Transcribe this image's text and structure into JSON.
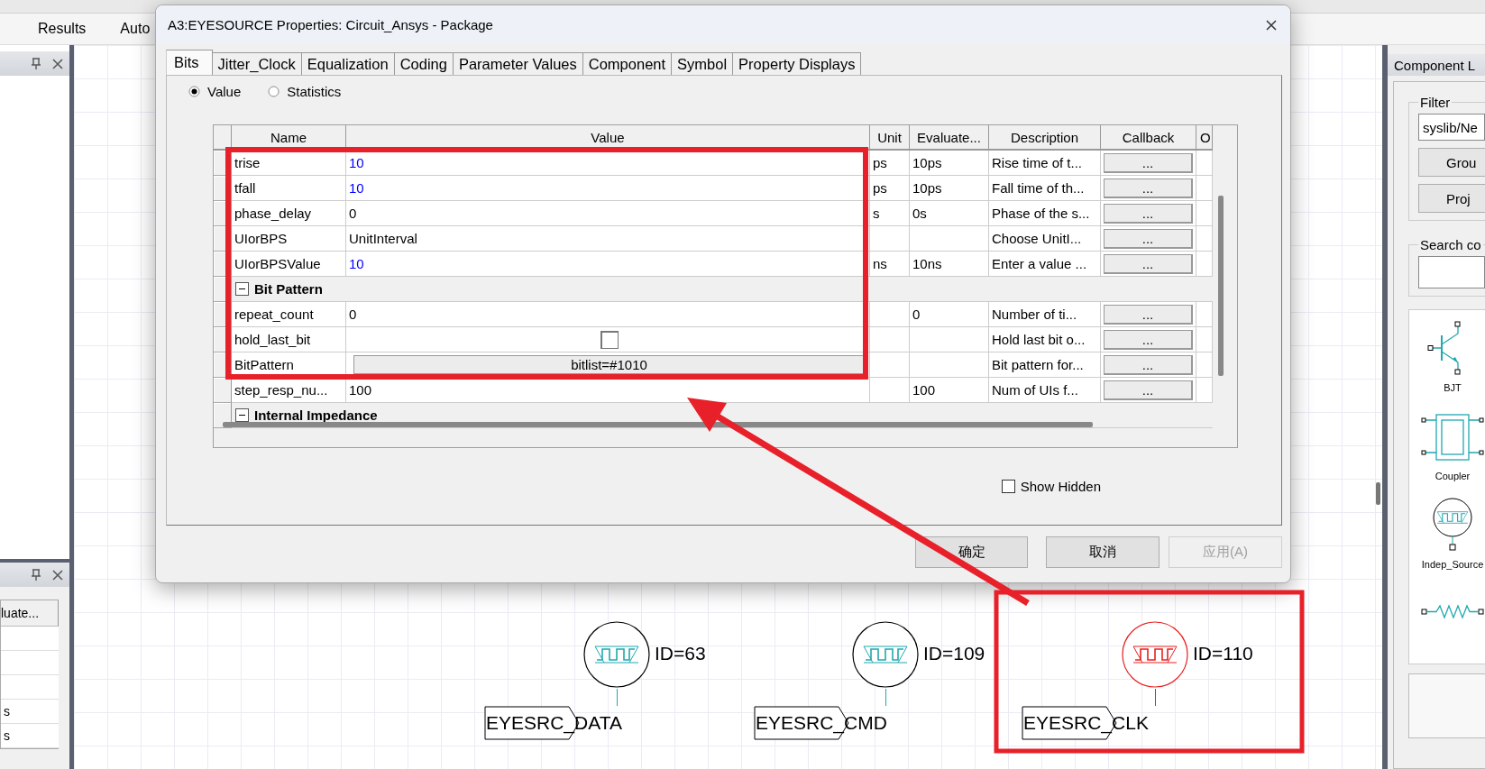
{
  "menu": [
    {
      "label": "Results"
    },
    {
      "label": "Auto"
    }
  ],
  "left_panel": {
    "table": {
      "columns": [
        "luate..."
      ],
      "cells": [
        "s",
        "s"
      ]
    }
  },
  "schematic": {
    "symbols": [
      {
        "id_label": "ID=63",
        "port": "EYESRC_DATA",
        "selected": false
      },
      {
        "id_label": "ID=109",
        "port": "EYESRC_CMD",
        "selected": false
      },
      {
        "id_label": "ID=110",
        "port": "EYESRC_CLK",
        "selected": true
      }
    ]
  },
  "library": {
    "title": "Component L",
    "filter_label": "Filter",
    "filter_value": "syslib/Ne",
    "buttons": [
      "Grou",
      "Proj"
    ],
    "search_label": "Search co",
    "items": [
      {
        "kind": "bjt",
        "label": "BJT"
      },
      {
        "kind": "coupler",
        "label": "Coupler"
      },
      {
        "kind": "source",
        "label": "Indep_Source"
      },
      {
        "kind": "resistor"
      }
    ]
  },
  "dialog": {
    "title": "A3:EYESOURCE Properties: Circuit_Ansys - Package",
    "tabs": [
      {
        "label": "Bits",
        "selected": true
      },
      {
        "label": "Jitter_Clock",
        "selected": false
      },
      {
        "label": "Equalization",
        "selected": false
      },
      {
        "label": "Coding",
        "selected": false
      },
      {
        "label": "Parameter Values",
        "selected": false
      },
      {
        "label": "Component",
        "selected": false
      },
      {
        "label": "Symbol",
        "selected": false
      },
      {
        "label": "Property Displays",
        "selected": false
      }
    ],
    "radios": [
      {
        "label": "Value",
        "selected": true
      },
      {
        "label": "Statistics",
        "selected": false
      }
    ],
    "table": {
      "columns": [
        "Name",
        "Value",
        "Unit",
        "Evaluate...",
        "Description",
        "Callback",
        "O"
      ],
      "rows": [
        {
          "kind": "param",
          "name": "trise",
          "value": "10",
          "color": "#0000ff",
          "unit": "ps",
          "evaluated": "10ps",
          "description": "Rise time of t...",
          "callback": "..."
        },
        {
          "kind": "param",
          "name": "tfall",
          "value": "10",
          "color": "#0000ff",
          "unit": "ps",
          "evaluated": "10ps",
          "description": "Fall time of th...",
          "callback": "..."
        },
        {
          "kind": "param",
          "name": "phase_delay",
          "value": "0",
          "color": "#000000",
          "unit": "s",
          "evaluated": "0s",
          "description": "Phase of the s...",
          "callback": "..."
        },
        {
          "kind": "param",
          "name": "UIorBPS",
          "value": "UnitInterval",
          "color": "#000000",
          "description": "Choose UnitI...",
          "callback": "..."
        },
        {
          "kind": "param",
          "name": "UIorBPSValue",
          "value": "10",
          "color": "#0000ff",
          "unit": "ns",
          "evaluated": "10ns",
          "description": "Enter a value ...",
          "callback": "..."
        },
        {
          "kind": "group",
          "label": "Bit Pattern",
          "expanded": true
        },
        {
          "kind": "param",
          "name": "repeat_count",
          "value": "0",
          "color": "#000000",
          "evaluated": "0",
          "description": "Number of ti...",
          "callback": "..."
        },
        {
          "kind": "checkbox",
          "name": "hold_last_bit",
          "checked": false,
          "description": "Hold last bit o...",
          "callback": "..."
        },
        {
          "kind": "button",
          "name": "BitPattern",
          "value": "bitlist=#1010",
          "description": "Bit pattern for...",
          "callback": "..."
        },
        {
          "kind": "param",
          "name": "step_resp_nu...",
          "value": "100",
          "color": "#000000",
          "evaluated": "100",
          "description": "Num of UIs f...",
          "callback": "..."
        },
        {
          "kind": "group",
          "label": "Internal Impedance",
          "expanded": true
        }
      ]
    },
    "show_hidden": {
      "label": "Show Hidden",
      "checked": false
    },
    "buttons": [
      {
        "label": "确定",
        "disabled": false
      },
      {
        "label": "取消",
        "disabled": false
      },
      {
        "label": "应用(A)",
        "disabled": true
      }
    ]
  }
}
